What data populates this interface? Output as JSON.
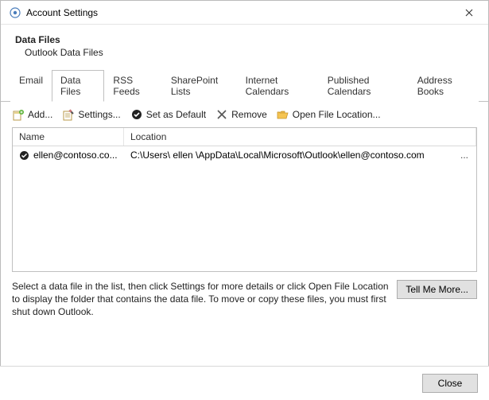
{
  "window": {
    "title": "Account Settings"
  },
  "header": {
    "title": "Data Files",
    "subtitle": "Outlook Data Files"
  },
  "tabs": {
    "email": "Email",
    "datafiles": "Data Files",
    "rss": "RSS Feeds",
    "sharepoint": "SharePoint Lists",
    "ical": "Internet Calendars",
    "pubcal": "Published Calendars",
    "addr": "Address Books"
  },
  "toolbar": {
    "add": "Add...",
    "settings": "Settings...",
    "default": "Set as Default",
    "remove": "Remove",
    "open": "Open File Location..."
  },
  "grid": {
    "col_name": "Name",
    "col_location": "Location",
    "rows": [
      {
        "name": "ellen@contoso.co...",
        "location": "C:\\Users\\  ellen   \\AppData\\Local\\Microsoft\\Outlook\\ellen@contoso.com",
        "ellipsis": "..."
      }
    ]
  },
  "help": {
    "text": "Select a data file in the list, then click Settings for more details or click Open File Location to display the folder that contains the data file. To move or copy these files, you must first shut down Outlook.",
    "more": "Tell Me More..."
  },
  "footer": {
    "close": "Close"
  }
}
